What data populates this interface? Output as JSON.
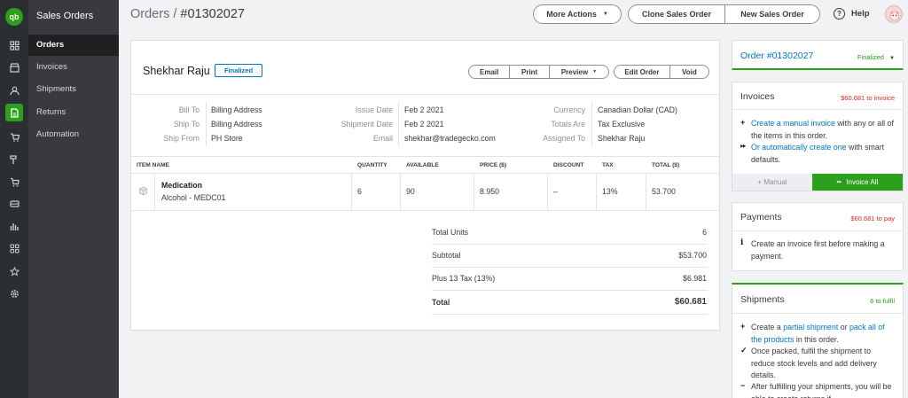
{
  "app": {
    "logo": "qb",
    "section_title": "Sales Orders"
  },
  "nav": {
    "items": [
      "Orders",
      "Invoices",
      "Shipments",
      "Returns",
      "Automation"
    ]
  },
  "header": {
    "breadcrumb_root": "Orders",
    "breadcrumb_sep": "/",
    "order_id": "#01302027",
    "more_actions": "More Actions",
    "clone": "Clone Sales Order",
    "new": "New Sales Order",
    "help": "Help"
  },
  "order": {
    "customer": "Shekhar Raju",
    "status": "Finalized",
    "actions": {
      "email": "Email",
      "print": "Print",
      "preview": "Preview",
      "edit": "Edit Order",
      "void": "Void"
    },
    "bill_to_label": "Bill To",
    "bill_to": "Billing Address",
    "ship_to_label": "Ship To",
    "ship_to": "Billing Address",
    "ship_from_label": "Ship From",
    "ship_from": "PH Store",
    "issue_date_label": "Issue Date",
    "issue_date": "Feb 2 2021",
    "shipment_date_label": "Shipment Date",
    "shipment_date": "Feb 2 2021",
    "email_label": "Email",
    "email": "shekhar@tradegecko.com",
    "currency_label": "Currency",
    "currency": "Canadian Dollar (CAD)",
    "totals_are_label": "Totals Are",
    "totals_are": "Tax Exclusive",
    "assigned_to_label": "Assigned To",
    "assigned_to": "Shekhar Raju"
  },
  "table": {
    "headers": [
      "ITEM NAME",
      "QUANTITY",
      "AVAILABLE",
      "PRICE ($)",
      "DISCOUNT",
      "TAX",
      "TOTAL ($)"
    ],
    "rows": [
      {
        "name": "Medication",
        "variant": "Alcohol - MEDC01",
        "quantity": "6",
        "available": "90",
        "price": "8.950",
        "discount": "–",
        "tax": "13%",
        "total": "53.700"
      }
    ]
  },
  "summary": {
    "units_label": "Total Units",
    "units": "6",
    "subtotal_label": "Subtotal",
    "subtotal": "$53.700",
    "tax_label": "Plus 13 Tax (13%)",
    "tax": "$6.981",
    "total_label": "Total",
    "total": "$60.681"
  },
  "panels": {
    "order": {
      "title": "Order #01302027",
      "status": "Finalized"
    },
    "invoices": {
      "title": "Invoices",
      "sub": "$60.681 to invoice",
      "l1_link": "Create a manual invoice",
      "l1_rest": " with any or all of the items in this order.",
      "l2_link": "Or automatically create one",
      "l2_rest": " with smart defaults.",
      "btn_manual": "+ Manual",
      "btn_all": "Invoice All"
    },
    "payments": {
      "title": "Payments",
      "sub": "$60.681 to pay",
      "text": "Create an invoice first before making a payment."
    },
    "shipments": {
      "title": "Shipments",
      "sub": "6 to fulfil",
      "s1_a": "Create a ",
      "s1_link1": "partial shipment",
      "s1_b": " or ",
      "s1_link2": "pack all of the products",
      "s1_c": " in this order.",
      "s2": "Once packed, fulfil the shipment to reduce stock levels and add delivery details.",
      "s3": "After fulfilling your shipments, you will be able to create returns if"
    }
  },
  "colors": {
    "accent": "#2ca01c",
    "link": "#0077c5",
    "warning": "#d52b1e",
    "sidebar": "#393a3d"
  }
}
